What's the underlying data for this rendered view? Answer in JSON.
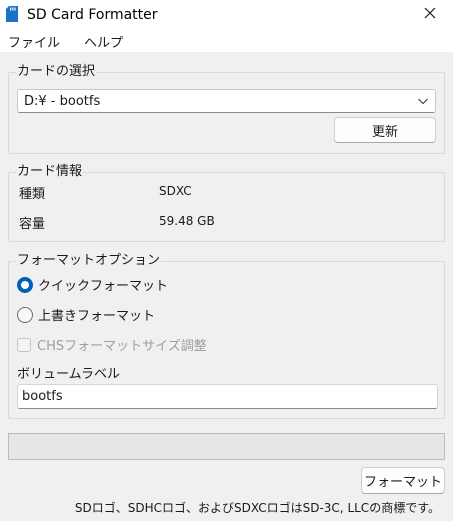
{
  "window": {
    "title": "SD Card Formatter",
    "icon": "sd-card-icon",
    "close_icon": "close-icon"
  },
  "menu": {
    "items": [
      "ファイル",
      "ヘルプ"
    ]
  },
  "card_select": {
    "legend": "カードの選択",
    "selected_value": "D:¥ - bootfs",
    "refresh_label": "更新"
  },
  "card_info": {
    "legend": "カード情報",
    "type_label": "種類",
    "type_value": "SDXC",
    "capacity_label": "容量",
    "capacity_value": "59.48 GB"
  },
  "format_options": {
    "legend": "フォーマットオプション",
    "quick_label": "クイックフォーマット",
    "quick_checked": true,
    "overwrite_label": "上書きフォーマット",
    "overwrite_checked": false,
    "chs_label": "CHSフォーマットサイズ調整",
    "chs_enabled": false,
    "volume_label_title": "ボリュームラベル",
    "volume_label_value": "bootfs"
  },
  "progress": {
    "value": 0
  },
  "actions": {
    "format_label": "フォーマット"
  },
  "footer": {
    "note": "SDロゴ、SDHCロゴ、およびSDXCロゴはSD-3C, LLCの商標です。"
  },
  "colors": {
    "accent": "#005fb8",
    "background": "#f0f0f0",
    "icon_blue": "#1a73c9"
  }
}
